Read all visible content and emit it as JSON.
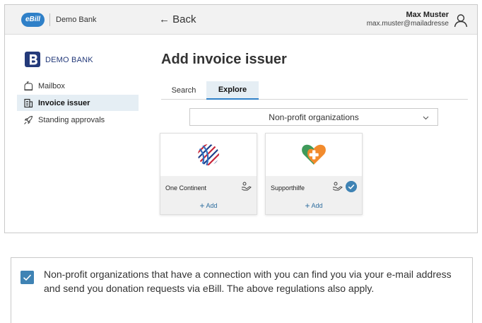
{
  "topbar": {
    "logo": "eBill",
    "bank_name": "Demo Bank",
    "back_label": "← Back",
    "user_name": "Max Muster",
    "user_email": "max.muster@mailadresse"
  },
  "sidebar": {
    "bank_logo_text": "DEMO BANK",
    "items": [
      {
        "label": "Mailbox",
        "icon": "mailbox-icon"
      },
      {
        "label": "Invoice issuer",
        "icon": "invoice-icon",
        "active": true
      },
      {
        "label": "Standing approvals",
        "icon": "rocket-icon"
      }
    ]
  },
  "main": {
    "title": "Add invoice issuer",
    "tabs": [
      {
        "label": "Search"
      },
      {
        "label": "Explore",
        "active": true
      }
    ],
    "category_select": "Non-profit organizations",
    "cards": [
      {
        "name": "One Continent",
        "add_label": "Add",
        "connected": false
      },
      {
        "name": "Supporthilfe",
        "add_label": "Add",
        "connected": true
      }
    ]
  },
  "info": {
    "checked": true,
    "text": "Non-profit organizations that have a connection with you can find you via your e-mail address and send you donation requests via eBill. The above regulations also apply."
  },
  "colors": {
    "accent": "#2f80c8",
    "check": "#3f83b4",
    "active_bg": "#e5eef4",
    "heart_orange": "#f28b2d",
    "heart_green": "#3f9a5a"
  }
}
